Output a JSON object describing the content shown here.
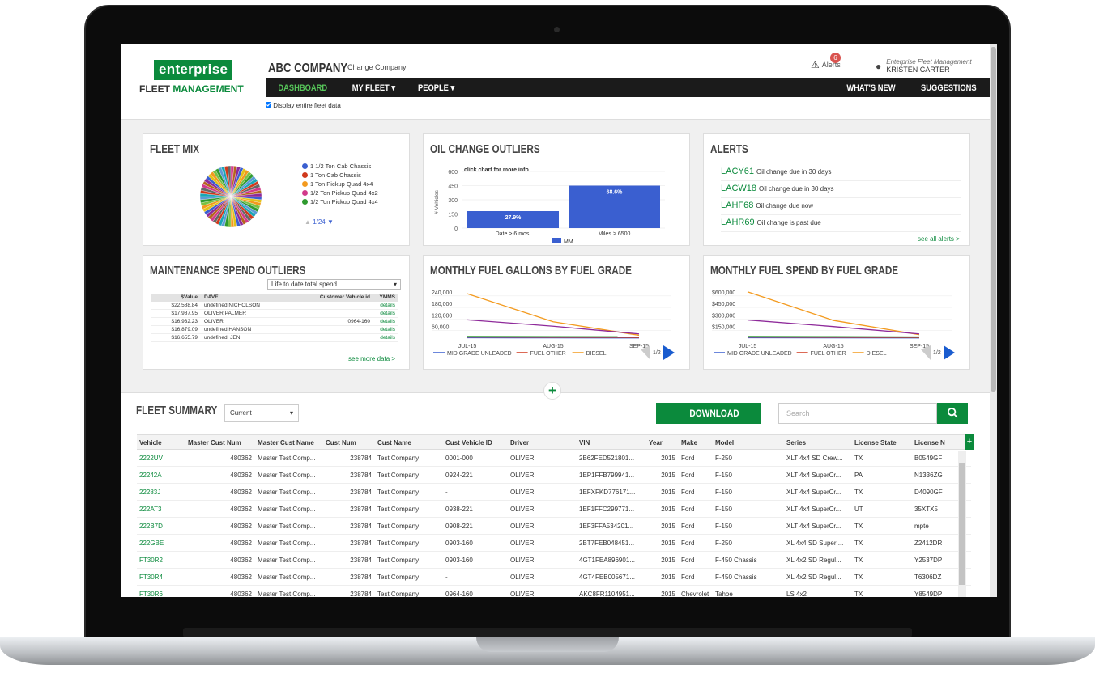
{
  "brand": {
    "wordmark": "enterprise",
    "sub_plain": "FLEET",
    "sub_green": "MANAGEMENT"
  },
  "header": {
    "company": "ABC COMPANY",
    "change_company": "Change Company",
    "alerts_label": "Alerts",
    "alerts_count": "6",
    "user_org": "Enterprise Fleet Management",
    "user_name": "KRISTEN CARTER"
  },
  "nav": {
    "dashboard": "DASHBOARD",
    "my_fleet": "MY FLEET",
    "people": "PEOPLE",
    "whats_new": "WHAT'S NEW",
    "suggestions": "SUGGESTIONS",
    "caret": "▾"
  },
  "display_entire": "Display entire fleet data",
  "fleet_mix": {
    "title": "FLEET MIX",
    "legend": [
      {
        "label": "1 1/2 Ton Cab Chassis",
        "color": "#3a5fd0"
      },
      {
        "label": "1 Ton Cab Chassis",
        "color": "#d0391c"
      },
      {
        "label": "1 Ton Pickup Quad 4x4",
        "color": "#f39a1e"
      },
      {
        "label": "1/2 Ton Pickup Quad 4x2",
        "color": "#d23a8a"
      },
      {
        "label": "1/2 Ton Pickup Quad 4x4",
        "color": "#2f9a2f"
      }
    ],
    "page": "1/24"
  },
  "oil_change": {
    "title": "OIL CHANGE OUTLIERS",
    "chart_data": {
      "type": "bar",
      "title": "click chart for more info",
      "ylabel": "# Vehicles",
      "categories": [
        "Date > 6 mos.",
        "Miles > 6500"
      ],
      "series": [
        {
          "name": "MM",
          "values": [
            180,
            450
          ]
        }
      ],
      "data_labels": [
        "27.9%",
        "68.6%"
      ],
      "yticks": [
        "600",
        "450",
        "300",
        "150",
        "0"
      ],
      "ylim": [
        0,
        600
      ]
    }
  },
  "alerts": {
    "title": "ALERTS",
    "items": [
      {
        "id": "LACY61",
        "text": "Oil change due in 30 days"
      },
      {
        "id": "LACW18",
        "text": "Oil change due in 30 days"
      },
      {
        "id": "LAHF68",
        "text": "Oil change due now"
      },
      {
        "id": "LAHR69",
        "text": "Oil change is past due"
      }
    ],
    "see_all": "see all alerts >"
  },
  "maintenance": {
    "title": "MAINTENANCE SPEND OUTLIERS",
    "select": "Life to date total spend",
    "columns": [
      "$Value",
      "DAVE",
      "Customer Vehicle id",
      "YMMS"
    ],
    "rows": [
      [
        "$22,588.84",
        "undefined NICHOLSON",
        "",
        "details"
      ],
      [
        "$17,987.95",
        "OLIVER PALMER",
        "",
        "details"
      ],
      [
        "$16,932.23",
        "OLIVER",
        "0964-160",
        "details"
      ],
      [
        "$16,879.09",
        "undefined HANSON",
        "",
        "details"
      ],
      [
        "$16,655.79",
        "undefined, JEN",
        "",
        "details"
      ]
    ],
    "see_more": "see more data >"
  },
  "fuel_gallons": {
    "title": "MONTHLY FUEL GALLONS BY FUEL GRADE",
    "page": "1/2",
    "chart_data": {
      "type": "line",
      "x": [
        "JUL-15",
        "AUG-15",
        "SEP-15"
      ],
      "yticks": [
        "240,000",
        "180,000",
        "120,000",
        "60,000"
      ],
      "ylim": [
        0,
        260000
      ],
      "series": [
        {
          "name": "MID GRADE UNLEADED",
          "color": "#3a5fd0",
          "values": [
            2000,
            1500,
            1000
          ]
        },
        {
          "name": "FUEL OTHER",
          "color": "#d0391c",
          "values": [
            6000,
            5000,
            4000
          ]
        },
        {
          "name": "DIESEL",
          "color": "#f39a1e",
          "values": [
            230000,
            85000,
            15000
          ]
        },
        {
          "name": "",
          "color": "#8e2a9a",
          "values": [
            95000,
            62000,
            22000
          ]
        },
        {
          "name": "",
          "color": "#2f9a2f",
          "values": [
            9000,
            8000,
            7000
          ]
        }
      ]
    }
  },
  "fuel_spend": {
    "title": "MONTHLY FUEL SPEND BY FUEL GRADE",
    "page": "1/2",
    "chart_data": {
      "type": "line",
      "x": [
        "JUL-15",
        "AUG-15",
        "SEP-15"
      ],
      "yticks": [
        "$600,000",
        "$450,000",
        "$300,000",
        "$150,000"
      ],
      "ylim": [
        0,
        650000
      ],
      "series": [
        {
          "name": "MID GRADE UNLEADED",
          "color": "#3a5fd0",
          "values": [
            5000,
            4000,
            3000
          ]
        },
        {
          "name": "FUEL OTHER",
          "color": "#d0391c",
          "values": [
            15000,
            12000,
            10000
          ]
        },
        {
          "name": "DIESEL",
          "color": "#f39a1e",
          "values": [
            600000,
            230000,
            45000
          ]
        },
        {
          "name": "",
          "color": "#8e2a9a",
          "values": [
            235000,
            150000,
            55000
          ]
        },
        {
          "name": "",
          "color": "#2f9a2f",
          "values": [
            22000,
            19000,
            16000
          ]
        }
      ]
    }
  },
  "summary": {
    "title": "FLEET SUMMARY",
    "select": "Current",
    "download": "DOWNLOAD",
    "search_placeholder": "Search",
    "columns": [
      "Vehicle",
      "Master Cust Num",
      "Master Cust Name",
      "Cust Num",
      "Cust Name",
      "Cust Vehicle ID",
      "Driver",
      "VIN",
      "Year",
      "Make",
      "Model",
      "Series",
      "License State",
      "License N"
    ],
    "rows": [
      [
        "2222UV",
        "480362",
        "Master Test Comp...",
        "238784",
        "Test Company",
        "0001-000",
        "OLIVER",
        "2B62FED521801...",
        "2015",
        "Ford",
        "F-250",
        "XLT 4x4 SD Crew...",
        "TX",
        "B0549GF"
      ],
      [
        "22242A",
        "480362",
        "Master Test Comp...",
        "238784",
        "Test Company",
        "0924-221",
        "OLIVER",
        "1EP1FFB799941...",
        "2015",
        "Ford",
        "F-150",
        "XLT 4x4 SuperCr...",
        "PA",
        "N1336ZG"
      ],
      [
        "22283J",
        "480362",
        "Master Test Comp...",
        "238784",
        "Test Company",
        "-",
        "OLIVER",
        "1EFXFKD776171...",
        "2015",
        "Ford",
        "F-150",
        "XLT 4x4 SuperCr...",
        "TX",
        "D4090GF"
      ],
      [
        "222AT3",
        "480362",
        "Master Test Comp...",
        "238784",
        "Test Company",
        "0938-221",
        "OLIVER",
        "1EF1FFC299771...",
        "2015",
        "Ford",
        "F-150",
        "XLT 4x4 SuperCr...",
        "UT",
        "35XTX5"
      ],
      [
        "222B7D",
        "480362",
        "Master Test Comp...",
        "238784",
        "Test Company",
        "0908-221",
        "OLIVER",
        "1EF3FFA534201...",
        "2015",
        "Ford",
        "F-150",
        "XLT 4x4 SuperCr...",
        "TX",
        "mpte"
      ],
      [
        "222GBE",
        "480362",
        "Master Test Comp...",
        "238784",
        "Test Company",
        "0903-160",
        "OLIVER",
        "2BT7FEB048451...",
        "2015",
        "Ford",
        "F-250",
        "XL 4x4 SD Super ...",
        "TX",
        "Z2412DR"
      ],
      [
        "FT30R2",
        "480362",
        "Master Test Comp...",
        "238784",
        "Test Company",
        "0903-160",
        "OLIVER",
        "4GT1FEA896901...",
        "2015",
        "Ford",
        "F-450 Chassis",
        "XL 4x2 SD Regul...",
        "TX",
        "Y2537DP"
      ],
      [
        "FT30R4",
        "480362",
        "Master Test Comp...",
        "238784",
        "Test Company",
        "-",
        "OLIVER",
        "4GT4FEB005671...",
        "2015",
        "Ford",
        "F-450 Chassis",
        "XL 4x2 SD Regul...",
        "TX",
        "T6306DZ"
      ],
      [
        "FT30R6",
        "480362",
        "Master Test Comp...",
        "238784",
        "Test Company",
        "0964-160",
        "OLIVER",
        "AKC8FR1104951...",
        "2015",
        "Chevrolet",
        "Tahoe",
        "LS 4x2",
        "TX",
        "Y8549DP"
      ]
    ]
  },
  "icons": {
    "warning": "⚠",
    "user": "👤",
    "search": "🔍",
    "add": "+",
    "next": "▶",
    "prev": "◀",
    "up": "▲",
    "down": "▼"
  }
}
